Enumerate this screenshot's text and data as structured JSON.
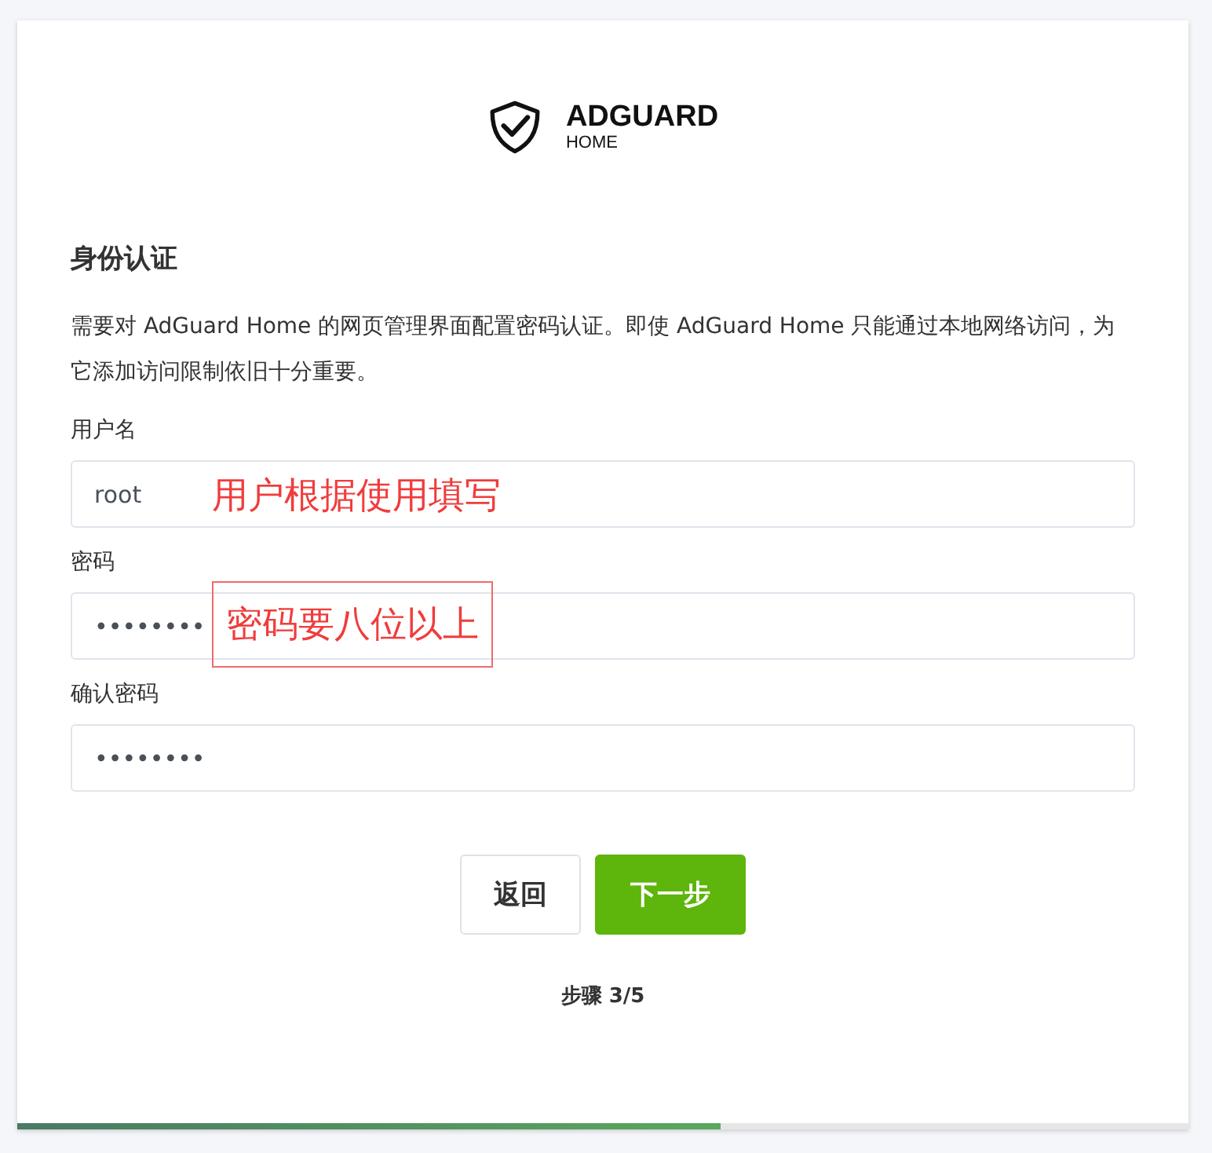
{
  "logo": {
    "name": "ADGUARD",
    "sub": "HOME"
  },
  "heading": "身份认证",
  "description": "需要对 AdGuard Home 的网页管理界面配置密码认证。即使 AdGuard Home 只能通过本地网络访问，为它添加访问限制依旧十分重要。",
  "fields": [
    {
      "label": "用户名",
      "value": "root",
      "annotation": {
        "text": "用户根据使用填写",
        "boxed": false
      }
    },
    {
      "label": "密码",
      "value": "••••••••",
      "annotation": {
        "text": "密码要八位以上",
        "boxed": true
      }
    },
    {
      "label": "确认密码",
      "value": "••••••••"
    }
  ],
  "buttons": [
    {
      "label": "返回",
      "kind": "secondary"
    },
    {
      "label": "下一步",
      "kind": "primary"
    }
  ],
  "step": "步骤 3/5",
  "progress": {
    "level": 0.6
  }
}
